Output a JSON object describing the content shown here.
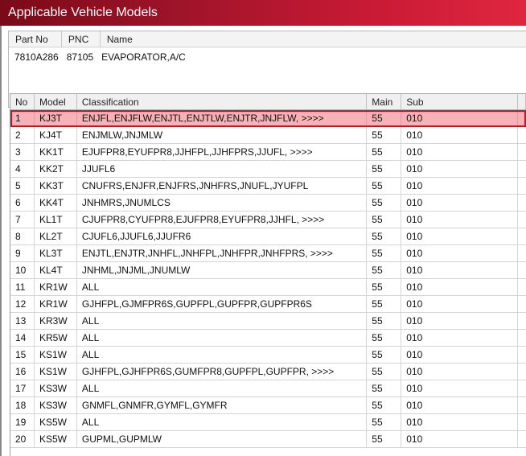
{
  "window": {
    "title": "Applicable Vehicle Models"
  },
  "part": {
    "headers": [
      "Part No",
      "PNC",
      "Name"
    ],
    "part_no": "7810A286",
    "pnc": "87105",
    "name": "EVAPORATOR,A/C"
  },
  "table": {
    "headers": {
      "no": "No",
      "model": "Model",
      "classification": "Classification",
      "main": "Main",
      "sub": "Sub"
    },
    "rows": [
      {
        "no": "1",
        "model": "KJ3T",
        "classification": "ENJFL,ENJFLW,ENJTL,ENJTLW,ENJTR,JNJFLW,  >>>>",
        "main": "55",
        "sub": "010"
      },
      {
        "no": "2",
        "model": "KJ4T",
        "classification": "ENJMLW,JNJMLW",
        "main": "55",
        "sub": "010"
      },
      {
        "no": "3",
        "model": "KK1T",
        "classification": "EJUFPR8,EYUFPR8,JJHFPL,JJHFPRS,JJUFL,  >>>>",
        "main": "55",
        "sub": "010"
      },
      {
        "no": "4",
        "model": "KK2T",
        "classification": "JJUFL6",
        "main": "55",
        "sub": "010"
      },
      {
        "no": "5",
        "model": "KK3T",
        "classification": "CNUFRS,ENJFR,ENJFRS,JNHFRS,JNUFL,JYUFPL",
        "main": "55",
        "sub": "010"
      },
      {
        "no": "6",
        "model": "KK4T",
        "classification": "JNHMRS,JNUMLCS",
        "main": "55",
        "sub": "010"
      },
      {
        "no": "7",
        "model": "KL1T",
        "classification": "CJUFPR8,CYUFPR8,EJUFPR8,EYUFPR8,JJHFL,  >>>>",
        "main": "55",
        "sub": "010"
      },
      {
        "no": "8",
        "model": "KL2T",
        "classification": "CJUFL6,JJUFL6,JJUFR6",
        "main": "55",
        "sub": "010"
      },
      {
        "no": "9",
        "model": "KL3T",
        "classification": "ENJTL,ENJTR,JNHFL,JNHFPL,JNHFPR,JNHFPRS,  >>>>",
        "main": "55",
        "sub": "010"
      },
      {
        "no": "10",
        "model": "KL4T",
        "classification": "JNHML,JNJML,JNUMLW",
        "main": "55",
        "sub": "010"
      },
      {
        "no": "11",
        "model": "KR1W",
        "classification": "ALL",
        "main": "55",
        "sub": "010"
      },
      {
        "no": "12",
        "model": "KR1W",
        "classification": "GJHFPL,GJMFPR6S,GUPFPL,GUPFPR,GUPFPR6S",
        "main": "55",
        "sub": "010"
      },
      {
        "no": "13",
        "model": "KR3W",
        "classification": "ALL",
        "main": "55",
        "sub": "010"
      },
      {
        "no": "14",
        "model": "KR5W",
        "classification": "ALL",
        "main": "55",
        "sub": "010"
      },
      {
        "no": "15",
        "model": "KS1W",
        "classification": "ALL",
        "main": "55",
        "sub": "010"
      },
      {
        "no": "16",
        "model": "KS1W",
        "classification": "GJHFPL,GJHFPR6S,GUMFPR8,GUPFPL,GUPFPR,  >>>>",
        "main": "55",
        "sub": "010"
      },
      {
        "no": "17",
        "model": "KS3W",
        "classification": "ALL",
        "main": "55",
        "sub": "010"
      },
      {
        "no": "18",
        "model": "KS3W",
        "classification": "GNMFL,GNMFR,GYMFL,GYMFR",
        "main": "55",
        "sub": "010"
      },
      {
        "no": "19",
        "model": "KS5W",
        "classification": "ALL",
        "main": "55",
        "sub": "010"
      },
      {
        "no": "20",
        "model": "KS5W",
        "classification": "GUPML,GUPMLW",
        "main": "55",
        "sub": "010"
      }
    ],
    "selected_index": 0
  },
  "colors": {
    "title_gradient_start": "#7a0a18",
    "title_gradient_end": "#e0263f",
    "selection_fill": "#f6b2b6",
    "selection_border": "#d01020"
  }
}
